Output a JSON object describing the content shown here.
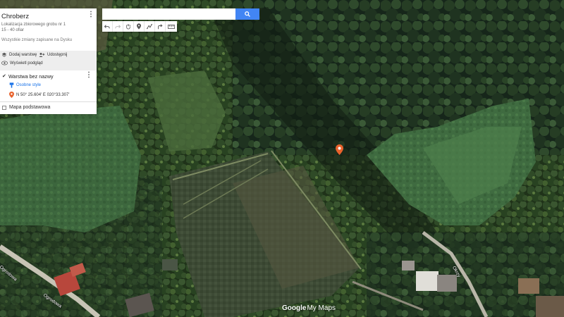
{
  "panel": {
    "title": "Chroberz",
    "description_line1": "Lokalizacja zbiorowego grobu nr 1",
    "description_line2": "15 - 40 ofiar",
    "saved_status": "Wszystkie zmiany zapisane na Dysku",
    "add_layer_label": "Dodaj warstwę",
    "share_label": "Udostępnij",
    "preview_label": "Wyświetl podgląd"
  },
  "layer": {
    "title": "Warstwa bez nazwy",
    "style_label": "Osobne style",
    "point_label": "N 50° 25.604' E 020°33.307'"
  },
  "basemap": {
    "label": "Mapa podstawowa"
  },
  "search": {
    "placeholder": ""
  },
  "streets": {
    "left": "Ogrodowa",
    "left_lower": "Ogrodowa",
    "right": "Okrzy"
  },
  "branding": {
    "google": "Google",
    "mymaps": "My Maps"
  },
  "colors": {
    "accent": "#4285f4",
    "pin": "#e8622c",
    "link": "#1a73e8"
  },
  "icons": [
    "search-icon",
    "undo-icon",
    "redo-icon",
    "hand-icon",
    "marker-icon",
    "line-icon",
    "directions-icon",
    "ruler-icon",
    "layers-icon",
    "share-icon",
    "eye-icon",
    "paint-icon",
    "pin-icon"
  ]
}
